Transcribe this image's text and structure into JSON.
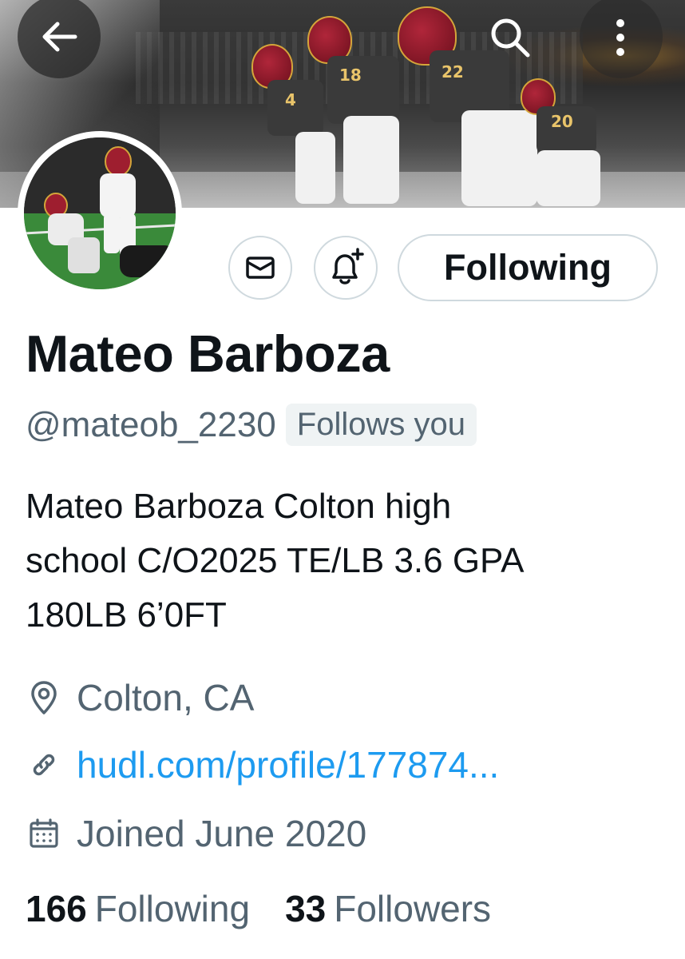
{
  "header": {
    "back_icon": "arrow-left-icon",
    "search_icon": "search-icon",
    "more_icon": "more-vertical-icon"
  },
  "banner": {
    "jersey_numbers": [
      "4",
      "18",
      "22",
      "20"
    ]
  },
  "actions": {
    "message_icon": "envelope-icon",
    "notify_icon": "bell-plus-icon",
    "following_label": "Following"
  },
  "profile": {
    "name": "Mateo Barboza",
    "handle": "@mateob_2230",
    "follows_you": "Follows you",
    "bio_lines": [
      "Mateo Barboza Colton high",
      "school C/O2025 TE/LB 3.6 GPA",
      "180LB 6’0FT"
    ],
    "location": "Colton, CA",
    "website": "hudl.com/profile/177874...",
    "joined": "Joined June 2020"
  },
  "stats": {
    "following_count": "166",
    "following_label": "Following",
    "followers_count": "33",
    "followers_label": "Followers"
  },
  "colors": {
    "text": "#0f1419",
    "secondary": "#536471",
    "link": "#1d9bf0",
    "border": "#cfd9de"
  }
}
